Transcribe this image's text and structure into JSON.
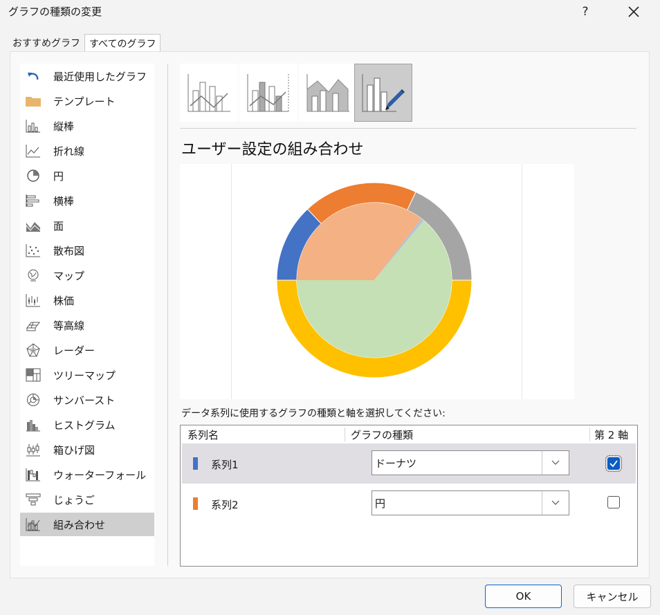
{
  "window": {
    "title": "グラフの種類の変更",
    "help_label": "?",
    "close_label": "✕"
  },
  "tabs": [
    {
      "label": "おすすめグラフ"
    },
    {
      "label": "すべてのグラフ"
    }
  ],
  "categories": [
    {
      "label": "最近使用したグラフ",
      "icon": "undo-icon"
    },
    {
      "label": "テンプレート",
      "icon": "folder-icon"
    },
    {
      "label": "縦棒",
      "icon": "column-chart-icon"
    },
    {
      "label": "折れ線",
      "icon": "line-chart-icon"
    },
    {
      "label": "円",
      "icon": "pie-chart-icon"
    },
    {
      "label": "横棒",
      "icon": "bar-chart-icon"
    },
    {
      "label": "面",
      "icon": "area-chart-icon"
    },
    {
      "label": "散布図",
      "icon": "scatter-chart-icon"
    },
    {
      "label": "マップ",
      "icon": "map-globe-icon"
    },
    {
      "label": "株価",
      "icon": "stock-chart-icon"
    },
    {
      "label": "等高線",
      "icon": "surface-chart-icon"
    },
    {
      "label": "レーダー",
      "icon": "radar-chart-icon"
    },
    {
      "label": "ツリーマップ",
      "icon": "treemap-icon"
    },
    {
      "label": "サンバースト",
      "icon": "sunburst-icon"
    },
    {
      "label": "ヒストグラム",
      "icon": "histogram-icon"
    },
    {
      "label": "箱ひげ図",
      "icon": "box-whisker-icon"
    },
    {
      "label": "ウォーターフォール",
      "icon": "waterfall-icon"
    },
    {
      "label": "じょうご",
      "icon": "funnel-icon"
    },
    {
      "label": "組み合わせ",
      "icon": "combo-chart-icon"
    }
  ],
  "selected_category": "組み合わせ",
  "subtypes": [
    {
      "icon": "clustered-column-line-icon"
    },
    {
      "icon": "clustered-column-line-secondary-axis-icon"
    },
    {
      "icon": "stacked-area-clustered-column-icon"
    },
    {
      "icon": "custom-combination-icon"
    }
  ],
  "heading": "ユーザー設定の組み合わせ",
  "chart_data": {
    "type": "pie",
    "series": [
      {
        "name": "系列1",
        "type": "doughnut",
        "colors": [
          "#4472c4",
          "#ed7d31",
          "#a5a5a5",
          "#ffc000"
        ],
        "values": [
          13,
          19,
          18,
          50
        ]
      },
      {
        "name": "系列2",
        "type": "pie",
        "colors": [
          "#f4b183",
          "#a9c4e6",
          "#c5e0b4"
        ],
        "values": [
          35.5,
          0.5,
          64
        ]
      }
    ]
  },
  "instruction": "データ系列に使用するグラフの種類と軸を選択してください:",
  "grid": {
    "headers": {
      "name": "系列名",
      "type": "グラフの種類",
      "axis": "第 2 軸"
    },
    "rows": [
      {
        "name": "系列1",
        "color": "#4472c4",
        "chart_type": "ドーナツ",
        "secondary_axis": true
      },
      {
        "name": "系列2",
        "color": "#ed7d31",
        "chart_type": "円",
        "secondary_axis": false
      }
    ]
  },
  "buttons": {
    "ok": "OK",
    "cancel": "キャンセル"
  }
}
